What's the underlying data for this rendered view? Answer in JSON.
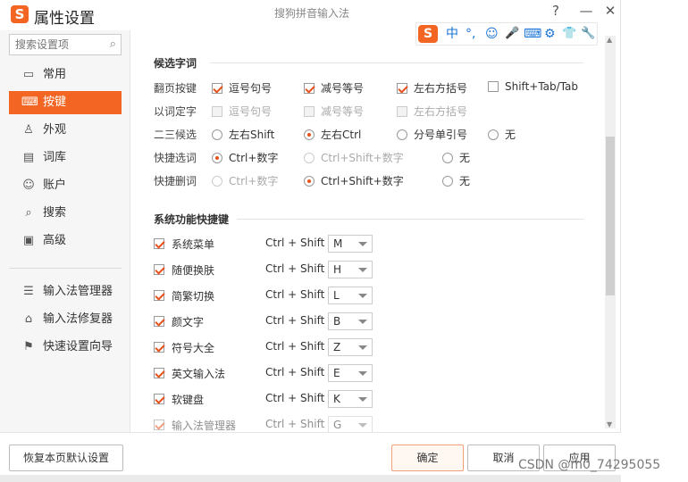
{
  "window": {
    "title": "属性设置",
    "app_title": "搜狗拼音输入法",
    "help": "?",
    "minimize": "—",
    "close": "✕"
  },
  "ime_bar": {
    "logo": "S",
    "lang": "中",
    "punct": "°,",
    "emoji": "☺",
    "voice": "🎤",
    "keyboard": "⌨",
    "toolbox": "⚙",
    "skin": "👕",
    "settings": "🔧"
  },
  "search": {
    "placeholder": "搜索设置项"
  },
  "sidebar": {
    "items": [
      {
        "label": "常用",
        "icon": "monitor-icon"
      },
      {
        "label": "按键",
        "icon": "keyboard-icon",
        "active": true
      },
      {
        "label": "外观",
        "icon": "shirt-icon"
      },
      {
        "label": "词库",
        "icon": "book-icon"
      },
      {
        "label": "账户",
        "icon": "user-icon"
      },
      {
        "label": "搜索",
        "icon": "search-icon"
      },
      {
        "label": "高级",
        "icon": "window-icon"
      }
    ],
    "tools": [
      {
        "label": "输入法管理器",
        "icon": "list-icon"
      },
      {
        "label": "输入法修复器",
        "icon": "toolbox-icon"
      },
      {
        "label": "快速设置向导",
        "icon": "flag-icon"
      }
    ]
  },
  "candidates": {
    "title": "候选字词",
    "page_keys": {
      "label": "翻页按键",
      "options": [
        "逗号句号",
        "减号等号",
        "左右方括号",
        "Shift+Tab/Tab"
      ],
      "checked": [
        true,
        true,
        true,
        false
      ]
    },
    "word_select": {
      "label": "以词定字",
      "options": [
        "逗号句号",
        "减号等号",
        "左右方括号"
      ]
    },
    "second_third": {
      "label": "二三候选",
      "options": [
        "左右Shift",
        "左右Ctrl",
        "分号单引号",
        "无"
      ],
      "selected": 1
    },
    "quick_select": {
      "label": "快捷选词",
      "options": [
        "Ctrl+数字",
        "Ctrl+Shift+数字",
        "无"
      ],
      "selected": 0
    },
    "quick_delete": {
      "label": "快捷删词",
      "options": [
        "Ctrl+数字",
        "Ctrl+Shift+数字",
        "无"
      ],
      "selected": 1
    }
  },
  "hotkeys": {
    "title": "系统功能快捷键",
    "modifier": "Ctrl + Shift +",
    "items": [
      {
        "name": "系统菜单",
        "key": "M"
      },
      {
        "name": "随便换肤",
        "key": "H"
      },
      {
        "name": "简繁切换",
        "key": "L"
      },
      {
        "name": "颜文字",
        "key": "B"
      },
      {
        "name": "符号大全",
        "key": "Z"
      },
      {
        "name": "英文输入法",
        "key": "E"
      },
      {
        "name": "软键盘",
        "key": "K"
      },
      {
        "name": "输入法管理器",
        "key": "G"
      }
    ]
  },
  "footer": {
    "reset": "恢复本页默认设置",
    "ok": "确定",
    "cancel": "取消",
    "apply": "应用"
  },
  "watermark": "CSDN @m0_74295055"
}
